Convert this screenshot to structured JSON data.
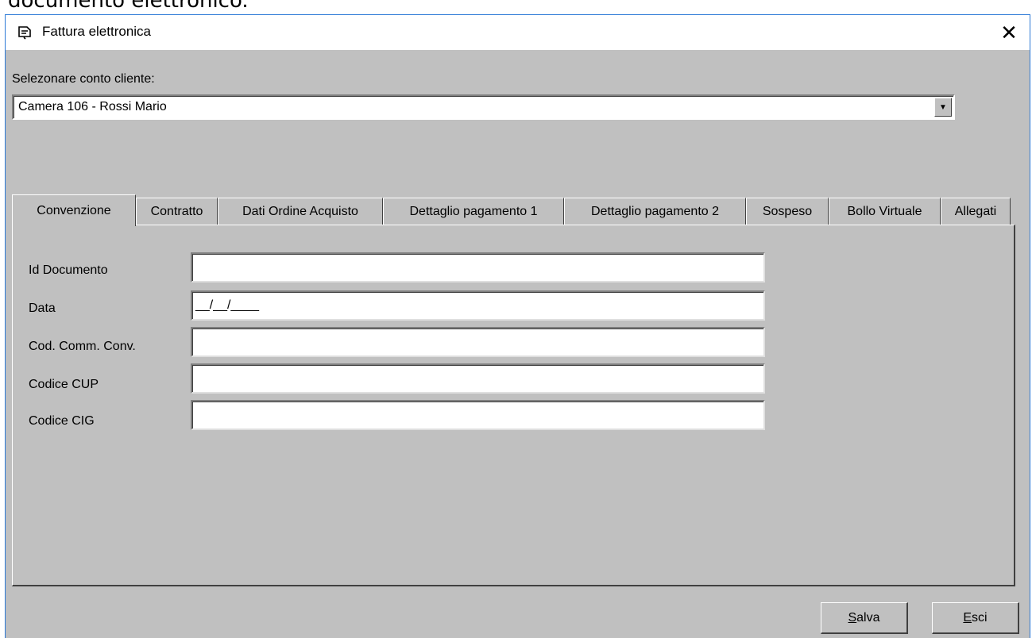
{
  "background_text": "documento elettronico.",
  "window": {
    "title": "Fattura elettronica",
    "close_symbol": "✕"
  },
  "account": {
    "label": "Selezonare conto cliente:",
    "selected": "Camera 106 - Rossi Mario",
    "dropdown_arrow": "▼"
  },
  "tabs": [
    {
      "label": "Convenzione",
      "active": true
    },
    {
      "label": "Contratto",
      "active": false
    },
    {
      "label": "Dati Ordine Acquisto",
      "active": false
    },
    {
      "label": "Dettaglio pagamento 1",
      "active": false
    },
    {
      "label": "Dettaglio pagamento 2",
      "active": false
    },
    {
      "label": "Sospeso",
      "active": false
    },
    {
      "label": "Bollo Virtuale",
      "active": false
    },
    {
      "label": "Allegati",
      "active": false
    }
  ],
  "fields": [
    {
      "label": "Id Documento",
      "value": ""
    },
    {
      "label": "Data",
      "value": "__/__/____"
    },
    {
      "label": "Cod. Comm. Conv.",
      "value": ""
    },
    {
      "label": "Codice CUP",
      "value": ""
    },
    {
      "label": "Codice CIG",
      "value": ""
    }
  ],
  "buttons": {
    "save_accel": "S",
    "save_rest": "alva",
    "exit_accel": "E",
    "exit_rest": "sci"
  },
  "colors": {
    "window_border": "#2b79d6",
    "face": "#c0c0c0"
  }
}
